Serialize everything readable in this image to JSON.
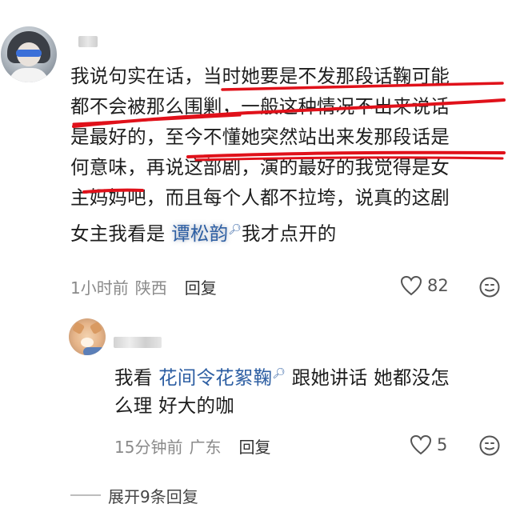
{
  "comment": {
    "lines": [
      {
        "pre": "我说句实在话，",
        "marked": "当时她要是不发那段话鞠可能"
      },
      {
        "marked": "都不会被那么围剿",
        "post": "，一般这种情况不出来说话"
      },
      {
        "pre": "是最好的，",
        "marked": "至今不懂她突然站出来发那段话是"
      },
      {
        "marked": "何意味",
        "post": "，再说这部剧，演的最好的我觉得是女"
      },
      {
        "text": "主妈妈吧，而且每个人都不拉垮，说真的这剧"
      },
      {
        "pre": "女主我看是 ",
        "mention": "谭松韵",
        "post": "我才点开的"
      }
    ],
    "time": "1小时前",
    "region": "陕西",
    "reply_label": "回复",
    "likes": "82"
  },
  "reply": {
    "lines": [
      {
        "pre": "我看 ",
        "mention": "花间令花絮鞠",
        "post": " 跟她讲话 她都没怎"
      },
      {
        "text": "么理 好大的咖"
      }
    ],
    "time": "15分钟前",
    "region": "广东",
    "reply_label": "回复",
    "likes": "5"
  },
  "expand": {
    "label": "展开9条回复"
  },
  "colors": {
    "underline": "#e0111a",
    "mention": "#2e5fa3",
    "meta": "#8a8a8a"
  },
  "icons": [
    "heart-icon",
    "comment-emoji-icon",
    "search-mention-icon"
  ]
}
